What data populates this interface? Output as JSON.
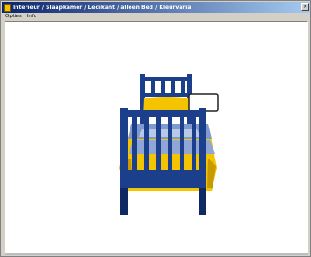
{
  "window": {
    "title": "Interieur / Slaapkamer / Ledikant / alleen Bed / Kleurvaria",
    "buttons": {
      "close_glyph": "×"
    }
  },
  "menubar": {
    "items": [
      {
        "label": "Opties"
      },
      {
        "label": "Info"
      }
    ]
  },
  "scene": {
    "subject": "bed-3d-view",
    "colors": {
      "frame": "#1b3f8b",
      "frame_dark": "#0f2a63",
      "bedding_yellow": "#f4c400",
      "bedding_shadow": "#c99a00",
      "sheet_blue": "#7e9ad0",
      "sheet_light": "#b8c8e8"
    }
  }
}
